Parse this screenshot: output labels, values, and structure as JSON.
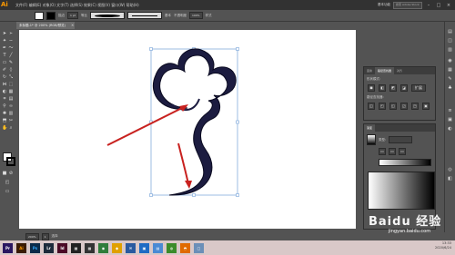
{
  "app": {
    "logo": "Ai",
    "menu": "文件(F)  编辑(E)  对象(O)  文字(T)  选择(S)  效果(C)  视图(V)  窗口(W)  帮助(H)",
    "workspace": "基本功能",
    "search_placeholder": "搜索 Adobe Stock"
  },
  "window": {
    "min": "–",
    "max": "□",
    "close": "×"
  },
  "control_bar": {
    "stroke_label": "描边",
    "stroke_value": "1 pt",
    "uniform_label": "等比",
    "basic_label": "基本",
    "opacity_label": "不透明度",
    "opacity_value": "100%",
    "style_label": "样式"
  },
  "document": {
    "tab_title": "未标题-1* @ 200% (RGB/预览)",
    "close": "×"
  },
  "status": {
    "zoom": "200%",
    "page": "1",
    "tool": "选择"
  },
  "panel1": {
    "tabs": [
      "变换",
      "路径查找器",
      "对齐"
    ],
    "active_tab": 1,
    "shape_modes_label": "形状模式:",
    "pathfinders_label": "路径查找器:",
    "expand_label": "扩展"
  },
  "panel2": {
    "tab": "渐变",
    "type_label": "类型:"
  },
  "taskbar": {
    "apps": [
      {
        "name": "Pr",
        "color": "#2a1660"
      },
      {
        "name": "Ai",
        "color": "#3a1b04"
      },
      {
        "name": "Ps",
        "color": "#0b2a4a"
      },
      {
        "name": "Lr",
        "color": "#1c2a3a"
      },
      {
        "name": "Id",
        "color": "#4b0a26"
      },
      {
        "name": "▦",
        "color": "#222"
      },
      {
        "name": "▦",
        "color": "#333"
      },
      {
        "name": "◉",
        "color": "#2f7d3b"
      },
      {
        "name": "◆",
        "color": "#e0a000"
      },
      {
        "name": "✉",
        "color": "#2a5aa0"
      },
      {
        "name": "▣",
        "color": "#1e6bc4"
      },
      {
        "name": "▤",
        "color": "#4a8ad4"
      },
      {
        "name": "◍",
        "color": "#3b8b2b"
      },
      {
        "name": "◓",
        "color": "#e06a00"
      },
      {
        "name": "▢",
        "color": "#6b8fb8"
      }
    ],
    "time": "13:33",
    "date": "2020/6/24"
  },
  "watermark": {
    "text": "Baidu 经验",
    "url": "jingyan.baidu.com"
  },
  "colors": {
    "arrow": "#c8211f",
    "shape_stroke": "#1a1a3a",
    "selection": "#5a8fd0"
  }
}
